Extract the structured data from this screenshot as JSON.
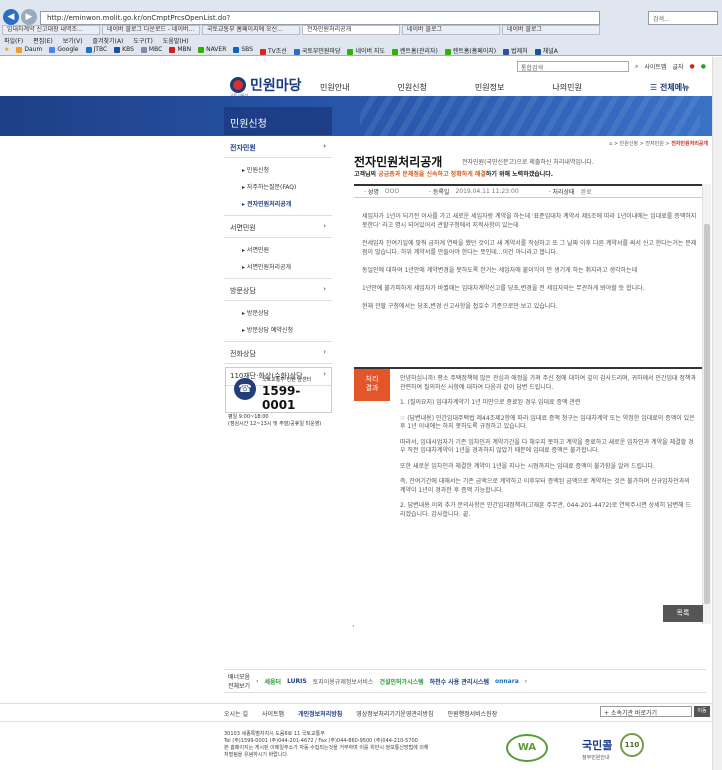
{
  "browser": {
    "url": "http://eminwon.molit.go.kr/onCmptPrcsOpenList.do?",
    "search_box": "검색...",
    "tabs": [
      "임대차계약 신고대장 내역조...",
      "네이버 블로그 다운로드 - 네이버...",
      "국토교통부 홈페이지에 오신...",
      "전자민원처리공개",
      "네이버 블로그",
      "네이버 블로그"
    ],
    "menu": [
      "파일(F)",
      "편집(E)",
      "보기(V)",
      "즐겨찾기(A)",
      "도구(T)",
      "도움말(H)"
    ],
    "favorites": [
      "Daum",
      "Google",
      "JTBC",
      "KBS",
      "MBC",
      "MBN",
      "NAVER",
      "SBS",
      "TV조선",
      "국토부민원마당",
      "네이버 지도",
      "렌트홈(관리자)",
      "렌트홈(홈페이지)",
      "법제처",
      "채널A"
    ]
  },
  "header": {
    "search_placeholder": "통합검색",
    "sitemap": "사이트맵",
    "font_label": "글자",
    "logo": "민원마당",
    "logo_sub": "국토교통부",
    "gnb": [
      "민원안내",
      "민원신청",
      "민원정보",
      "나의민원"
    ],
    "all_menu": "전체메뉴"
  },
  "sidebar": {
    "title": "민원신청",
    "groups": [
      {
        "label": "전자민원",
        "active": true,
        "items": [
          {
            "label": "민원신청",
            "active": false
          },
          {
            "label": "자주하는질문(FAQ)",
            "active": false
          },
          {
            "label": "전자민원처리공개",
            "active": true
          }
        ]
      },
      {
        "label": "서면민원",
        "active": false,
        "items": [
          {
            "label": "서면민원",
            "active": false
          },
          {
            "label": "서면민원처리공개",
            "active": false
          }
        ]
      },
      {
        "label": "방문상담",
        "active": false,
        "items": [
          {
            "label": "방문상담",
            "active": false
          },
          {
            "label": "방문상담 예약신청",
            "active": false
          }
        ]
      },
      {
        "label": "전화상담",
        "active": false,
        "items": []
      },
      {
        "label": "110재단·화상(수화)상담",
        "active": false,
        "items": []
      }
    ],
    "call_center": {
      "label": "국토교통부 민원 콜센터",
      "number": "1599-0001",
      "hours1": "평일 9:00~18:00",
      "hours2": "(점심시간 12~13시 및 주말/공휴일 미운영)"
    }
  },
  "content": {
    "breadcrumb": [
      "민원신청",
      "전자민원",
      "전자민원처리공개"
    ],
    "title": "전자민원처리공개",
    "title_note": "전자민원(국민신문고)으로 제출하신 처리내역입니다.",
    "subtitle_prefix": "고객님의 ",
    "subtitle_em": "궁금증과 문제점을 신속하고 정확하게 해결",
    "subtitle_suffix": "하기 위해 노력하겠습니다.",
    "info": {
      "name_label": "성명",
      "name": "OOO",
      "date_label": "등록일",
      "date": "2019.04.11 11:23:00",
      "status_label": "처리상태",
      "status": "완료"
    },
    "question": [
      "세입자가 1년이 되기전 이사를 가고 새로운 세입자랑 계약을 하는데 '표준임대차 계약서 제5조에 따라 1년이내에는 임대료를 증액하지 못한다' 라고 명시 되어있어서 관할구청에서 지적사항이 있는데",
      "전세입자 잔여기일에 맞춰 급하게 연락을 했던 것이고 새 계약서를 작성하고 또 그 날짜 이후 다른 계약서를 써서 신고 한다는거는 문제점이 많습니다. 하위 계약서를 만들어야 한다는 뜻인데...이건 아니라고 봅니다.",
      "동일인에 대하여 1년안에 계약변경을 못하도록 한거는 세입자에 붙이익이 안 생기게 하는 취지라고 생각하는데",
      "1년안에 불가피하게 세입자가 바뀔때는 임대차계약신고를 당초,변경을 전 세입자와는 무관하게 봐야할 듯 합니다.",
      "현재 관할 구청에서는 당초,변경 신고사항을 접호수 기준으로만 보고 있습니다."
    ],
    "answer_badge": "처리\n결과",
    "answer": [
      "안녕하십니까! 평소 주택정책에 많은 관심과 애정을 가져 주신 점에 대하여 깊이 감사드리며, 귀하께서 민간임대 정책과 관련하여 질의하신 사항에 대하여 다음과 같이 답변 드립니다.",
      "1. (질의요지) 임대차계약기 1년 미만으로 종료된 경우 임대료 증액 관련",
      "☞ (답변내용) 민간임대주택법 제44조제2항에 따라 임대료 증액 청구는 임대차계약 또는 약정한 임대료의 증액이 있은 후 1년 이내에는 하지 못하도록 규정하고 있습니다.",
      "따라서, 임대사업자가 기존 임차인과 계약기간을 다 채우지 못하고 계약을 종료하고 새로운 임차인과 계약을 체결할 경우 직전 임대차계약이 1년을 경과하지 않았기 때문에 임대료 증액은 불가합니다.",
      "또한 새로운 임차인과 체결한 계약이 1년을 지나는 시점까지는 임대료 증액이 불가함을 알려 드립니다.",
      "즉, 잔여기간에 대해서는 기존 금액으로 계약하고 이후부터 증액된 금액으로 계약하는 것은 불가하며 신규임차인과의 계약이 1년이 경과한 후 증액 가능합니다.",
      "2. 답변내용 이외 추가 문의사항은 민간임대정책과(고재훈 주무관, 044-201-4472)로 연락주시면 상세히 답변해 드리겠습니다. 감사합니다. 끝."
    ],
    "list_button": "목록"
  },
  "banners": {
    "label": "배너모음",
    "all": "전체보기",
    "items": [
      "세움터",
      "LURIS",
      "토지이용규제정보서비스",
      "건설인허가시스템",
      "하천수 사용 관리시스템",
      "onnara"
    ]
  },
  "footer": {
    "links": [
      "오시는 길",
      "사이트맵",
      "개인정보처리방침",
      "영상정보처리기기운영관리방침",
      "민원행정서비스헌장"
    ],
    "select": "+ 소속기관 바로가기",
    "go": "이동",
    "address": [
      "30103 세종특별자치시 도움6로 11 국토교통부",
      "Tel (주)1599-0001 (주)044-201-4672 / Fax (주)044-860-9500 (주)044-210-5700",
      "본 홈페이지는 게시된 이메일주소가 자동 수집되는것을 거부하며 이를 위반시 정보통신망법에 의해",
      "처벌됨을 유념하시기 바랍니다."
    ],
    "wa": "WA",
    "cert": "국민콜",
    "cert_num": "110",
    "cert_sub": "정부민원안내"
  },
  "colors": {
    "brand": "#1d3e86",
    "accent": "#e2562a"
  }
}
